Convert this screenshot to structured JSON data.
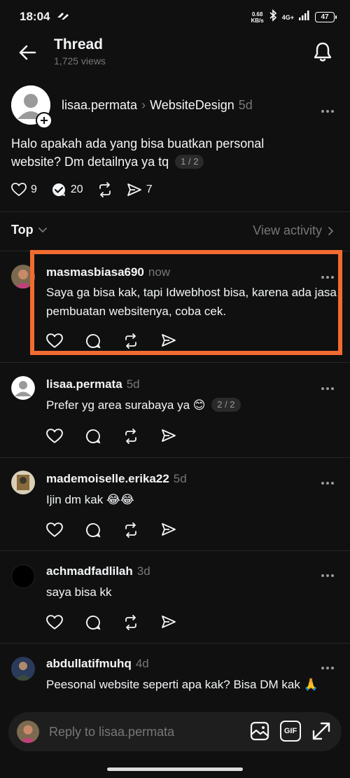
{
  "status_bar": {
    "time": "18:04",
    "speed_value": "0.68",
    "speed_unit": "KB/s",
    "network": "4G+",
    "battery": "47"
  },
  "header": {
    "title": "Thread",
    "views": "1,725 views"
  },
  "post": {
    "username": "lisaa.permata",
    "separator": "›",
    "community": "WebsiteDesign",
    "time": "5d",
    "text": "Halo apakah ada yang bisa buatkan personal website? Dm detailnya ya tq",
    "pager": "1 / 2",
    "likes": "9",
    "replies": "20",
    "shares": "7"
  },
  "sort": {
    "label": "Top",
    "view_activity": "View activity"
  },
  "replies": [
    {
      "username": "masmasbiasa690",
      "time": "now",
      "text": "Saya ga bisa kak, tapi Idwebhost bisa, karena ada jasa pembuatan websitenya, coba cek."
    },
    {
      "username": "lisaa.permata",
      "time": "5d",
      "text": "Prefer yg area surabaya ya 😊",
      "pager": "2 / 2"
    },
    {
      "username": "mademoiselle.erika22",
      "time": "5d",
      "text": "Ijin dm kak 😂😂"
    },
    {
      "username": "achmadfadlilah",
      "time": "3d",
      "text": "saya bisa kk"
    },
    {
      "username": "abdullatifmuhq",
      "time": "4d",
      "text": "Peesonal website seperti apa kak? Bisa DM kak 🙏"
    }
  ],
  "composer": {
    "placeholder": "Reply to lisaa.permata",
    "gif_label": "GIF"
  },
  "colors": {
    "background": "#101010",
    "highlight": "#f26b30",
    "muted": "#777777"
  }
}
